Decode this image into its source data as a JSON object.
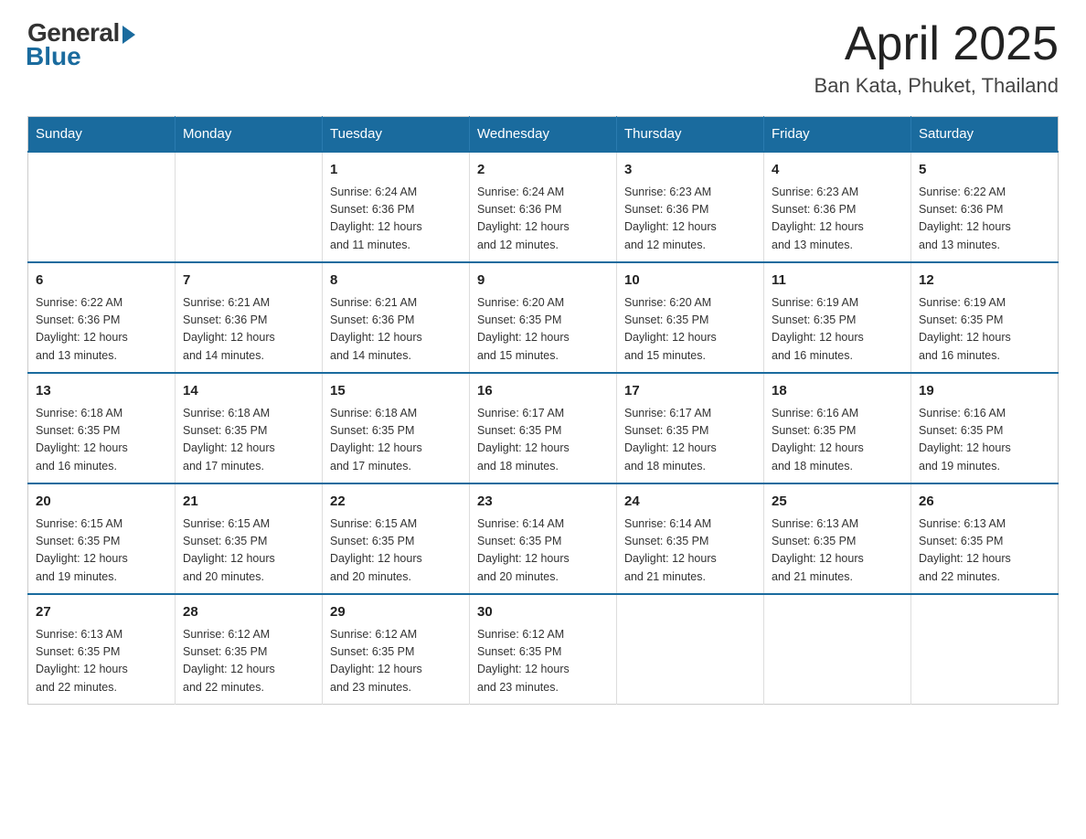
{
  "header": {
    "logo_general": "General",
    "logo_blue": "Blue",
    "month_title": "April 2025",
    "location": "Ban Kata, Phuket, Thailand"
  },
  "calendar": {
    "days_of_week": [
      "Sunday",
      "Monday",
      "Tuesday",
      "Wednesday",
      "Thursday",
      "Friday",
      "Saturday"
    ],
    "weeks": [
      [
        {
          "day": "",
          "info": ""
        },
        {
          "day": "",
          "info": ""
        },
        {
          "day": "1",
          "info": "Sunrise: 6:24 AM\nSunset: 6:36 PM\nDaylight: 12 hours\nand 11 minutes."
        },
        {
          "day": "2",
          "info": "Sunrise: 6:24 AM\nSunset: 6:36 PM\nDaylight: 12 hours\nand 12 minutes."
        },
        {
          "day": "3",
          "info": "Sunrise: 6:23 AM\nSunset: 6:36 PM\nDaylight: 12 hours\nand 12 minutes."
        },
        {
          "day": "4",
          "info": "Sunrise: 6:23 AM\nSunset: 6:36 PM\nDaylight: 12 hours\nand 13 minutes."
        },
        {
          "day": "5",
          "info": "Sunrise: 6:22 AM\nSunset: 6:36 PM\nDaylight: 12 hours\nand 13 minutes."
        }
      ],
      [
        {
          "day": "6",
          "info": "Sunrise: 6:22 AM\nSunset: 6:36 PM\nDaylight: 12 hours\nand 13 minutes."
        },
        {
          "day": "7",
          "info": "Sunrise: 6:21 AM\nSunset: 6:36 PM\nDaylight: 12 hours\nand 14 minutes."
        },
        {
          "day": "8",
          "info": "Sunrise: 6:21 AM\nSunset: 6:36 PM\nDaylight: 12 hours\nand 14 minutes."
        },
        {
          "day": "9",
          "info": "Sunrise: 6:20 AM\nSunset: 6:35 PM\nDaylight: 12 hours\nand 15 minutes."
        },
        {
          "day": "10",
          "info": "Sunrise: 6:20 AM\nSunset: 6:35 PM\nDaylight: 12 hours\nand 15 minutes."
        },
        {
          "day": "11",
          "info": "Sunrise: 6:19 AM\nSunset: 6:35 PM\nDaylight: 12 hours\nand 16 minutes."
        },
        {
          "day": "12",
          "info": "Sunrise: 6:19 AM\nSunset: 6:35 PM\nDaylight: 12 hours\nand 16 minutes."
        }
      ],
      [
        {
          "day": "13",
          "info": "Sunrise: 6:18 AM\nSunset: 6:35 PM\nDaylight: 12 hours\nand 16 minutes."
        },
        {
          "day": "14",
          "info": "Sunrise: 6:18 AM\nSunset: 6:35 PM\nDaylight: 12 hours\nand 17 minutes."
        },
        {
          "day": "15",
          "info": "Sunrise: 6:18 AM\nSunset: 6:35 PM\nDaylight: 12 hours\nand 17 minutes."
        },
        {
          "day": "16",
          "info": "Sunrise: 6:17 AM\nSunset: 6:35 PM\nDaylight: 12 hours\nand 18 minutes."
        },
        {
          "day": "17",
          "info": "Sunrise: 6:17 AM\nSunset: 6:35 PM\nDaylight: 12 hours\nand 18 minutes."
        },
        {
          "day": "18",
          "info": "Sunrise: 6:16 AM\nSunset: 6:35 PM\nDaylight: 12 hours\nand 18 minutes."
        },
        {
          "day": "19",
          "info": "Sunrise: 6:16 AM\nSunset: 6:35 PM\nDaylight: 12 hours\nand 19 minutes."
        }
      ],
      [
        {
          "day": "20",
          "info": "Sunrise: 6:15 AM\nSunset: 6:35 PM\nDaylight: 12 hours\nand 19 minutes."
        },
        {
          "day": "21",
          "info": "Sunrise: 6:15 AM\nSunset: 6:35 PM\nDaylight: 12 hours\nand 20 minutes."
        },
        {
          "day": "22",
          "info": "Sunrise: 6:15 AM\nSunset: 6:35 PM\nDaylight: 12 hours\nand 20 minutes."
        },
        {
          "day": "23",
          "info": "Sunrise: 6:14 AM\nSunset: 6:35 PM\nDaylight: 12 hours\nand 20 minutes."
        },
        {
          "day": "24",
          "info": "Sunrise: 6:14 AM\nSunset: 6:35 PM\nDaylight: 12 hours\nand 21 minutes."
        },
        {
          "day": "25",
          "info": "Sunrise: 6:13 AM\nSunset: 6:35 PM\nDaylight: 12 hours\nand 21 minutes."
        },
        {
          "day": "26",
          "info": "Sunrise: 6:13 AM\nSunset: 6:35 PM\nDaylight: 12 hours\nand 22 minutes."
        }
      ],
      [
        {
          "day": "27",
          "info": "Sunrise: 6:13 AM\nSunset: 6:35 PM\nDaylight: 12 hours\nand 22 minutes."
        },
        {
          "day": "28",
          "info": "Sunrise: 6:12 AM\nSunset: 6:35 PM\nDaylight: 12 hours\nand 22 minutes."
        },
        {
          "day": "29",
          "info": "Sunrise: 6:12 AM\nSunset: 6:35 PM\nDaylight: 12 hours\nand 23 minutes."
        },
        {
          "day": "30",
          "info": "Sunrise: 6:12 AM\nSunset: 6:35 PM\nDaylight: 12 hours\nand 23 minutes."
        },
        {
          "day": "",
          "info": ""
        },
        {
          "day": "",
          "info": ""
        },
        {
          "day": "",
          "info": ""
        }
      ]
    ]
  }
}
